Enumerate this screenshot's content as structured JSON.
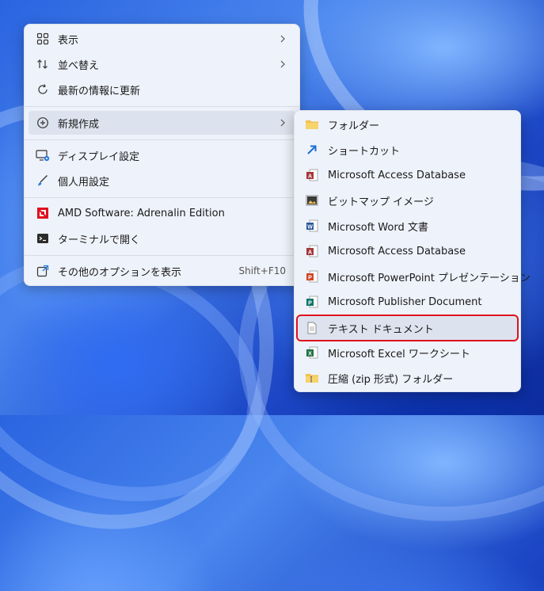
{
  "context_menu": {
    "items": [
      {
        "label": "表示",
        "icon": "grid-view-icon"
      },
      {
        "label": "並べ替え",
        "icon": "sort-icon"
      },
      {
        "label": "最新の情報に更新",
        "icon": "refresh-icon"
      },
      {
        "label": "新規作成",
        "icon": "add-circle-icon"
      },
      {
        "label": "ディスプレイ設定",
        "icon": "display-settings-icon"
      },
      {
        "label": "個人用設定",
        "icon": "brush-icon"
      },
      {
        "label": "AMD Software: Adrenalin Edition",
        "icon": "amd-logo-icon"
      },
      {
        "label": "ターミナルで開く",
        "icon": "terminal-icon"
      },
      {
        "label": "その他のオプションを表示",
        "icon": "more-options-icon",
        "shortcut": "Shift+F10"
      }
    ]
  },
  "new_submenu": {
    "items": [
      {
        "label": "フォルダー",
        "icon": "folder-icon"
      },
      {
        "label": "ショートカット",
        "icon": "shortcut-arrow-icon"
      },
      {
        "label": "Microsoft Access Database",
        "icon": "access-icon"
      },
      {
        "label": "ビットマップ イメージ",
        "icon": "bitmap-icon"
      },
      {
        "label": "Microsoft Word 文書",
        "icon": "word-icon"
      },
      {
        "label": "Microsoft Access Database",
        "icon": "access-icon"
      },
      {
        "label": "Microsoft PowerPoint プレゼンテーション",
        "icon": "powerpoint-icon"
      },
      {
        "label": "Microsoft Publisher Document",
        "icon": "publisher-icon"
      },
      {
        "label": "テキスト ドキュメント",
        "icon": "text-document-icon"
      },
      {
        "label": "Microsoft Excel ワークシート",
        "icon": "excel-icon"
      },
      {
        "label": "圧縮 (zip 形式) フォルダー",
        "icon": "zip-folder-icon"
      }
    ]
  },
  "colors": {
    "highlight_border": "#e01020",
    "menu_background": "#eef2fa",
    "folder": "#f2c14e",
    "access": "#a4373a",
    "word": "#2b579a",
    "powerpoint": "#d24726",
    "publisher": "#077568",
    "excel": "#217346",
    "amd": "#e01020"
  }
}
